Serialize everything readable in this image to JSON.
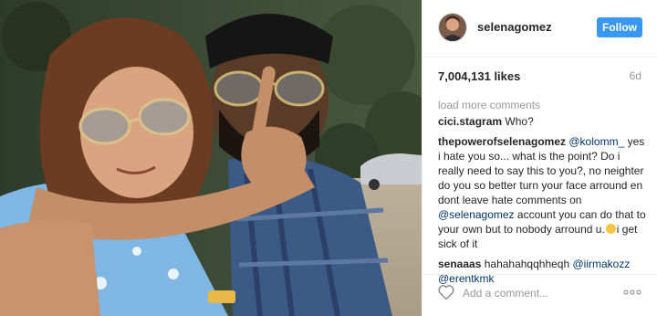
{
  "header": {
    "username": "selenagomez",
    "follow_label": "Follow",
    "avatar_icon": "profile-photo"
  },
  "stats": {
    "likes": "7,004,131 likes",
    "age": "6d"
  },
  "load_more_label": "load more comments",
  "comments": [
    {
      "author": "cici.stagram",
      "text": "Who?"
    },
    {
      "author": "thepowerofselenagomez",
      "mention1": "@kolomm_",
      "text1": " yes i hate you so... what is the point? Do i really need to say this to you?, no neighter do you so better turn your face arround en dont leave hate comments on ",
      "mention2": "@selenagomez",
      "text2": " account you can do that to your own but to nobody arround u.",
      "text3": "i get sick of it"
    },
    {
      "author": "senaaas",
      "text1": "hahahahqqhheqh ",
      "mention1": "@iirmakozz",
      "mention2": "@erentkmk"
    }
  ],
  "footer": {
    "comment_placeholder": "Add a comment...",
    "like_icon": "heart-outline",
    "more_icon": "ellipsis"
  },
  "colors": {
    "accent": "#3897f0",
    "mention": "#003569",
    "muted": "#999999"
  }
}
